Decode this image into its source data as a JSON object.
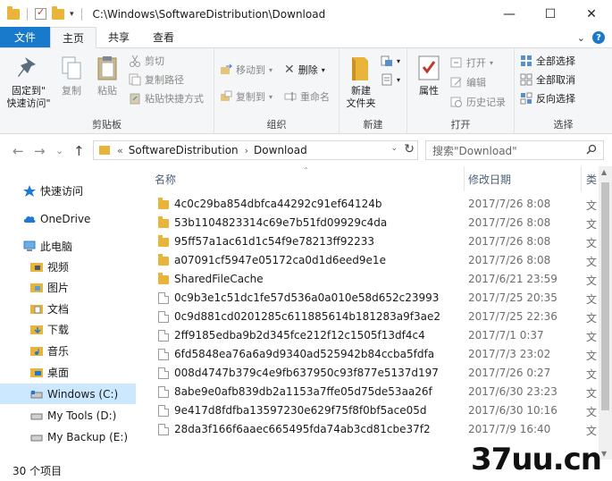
{
  "titlebar": {
    "title": "C:\\Windows\\SoftwareDistribution\\Download",
    "dropdown": "▾",
    "minimize": "—",
    "maximize": "☐",
    "close": "✕"
  },
  "tabs": {
    "file": "文件",
    "home": "主页",
    "share": "共享",
    "view": "查看",
    "collapse": "⌄",
    "help": "?"
  },
  "ribbon": {
    "clipboard": {
      "label": "剪贴板",
      "pin": "固定到\"\n快速访问\"",
      "pin_line1": "固定到\"",
      "pin_line2": "快速访问\"",
      "copy": "复制",
      "paste": "粘贴",
      "cut": "剪切",
      "copy_path": "复制路径",
      "paste_shortcut": "粘贴快捷方式"
    },
    "organize": {
      "label": "组织",
      "move_to": "移动到",
      "copy_to": "复制到",
      "delete": "删除",
      "rename": "重命名"
    },
    "new": {
      "label": "新建",
      "new_folder_line1": "新建",
      "new_folder_line2": "文件夹"
    },
    "open": {
      "label": "打开",
      "properties": "属性",
      "open": "打开",
      "edit": "编辑",
      "history": "历史记录"
    },
    "select": {
      "label": "选择",
      "select_all": "全部选择",
      "select_none": "全部取消",
      "invert": "反向选择"
    }
  },
  "nav": {
    "back": "←",
    "forward": "→",
    "recent": "⌄",
    "up": "↑",
    "address_prefix": "«",
    "address_segments": [
      "SoftwareDistribution",
      "Download"
    ],
    "address_arrow": "›",
    "address_drop": "⌄",
    "refresh": "↻",
    "search_placeholder": "搜索\"Download\"",
    "search_icon": "⌕"
  },
  "navpane": {
    "items": [
      {
        "label": "快速访问",
        "icon": "star-icon"
      },
      {
        "label": "OneDrive",
        "icon": "cloud-icon"
      },
      {
        "label": "此电脑",
        "icon": "computer-icon"
      },
      {
        "label": "视频",
        "icon": "video-folder-icon"
      },
      {
        "label": "图片",
        "icon": "pictures-folder-icon"
      },
      {
        "label": "文档",
        "icon": "documents-folder-icon"
      },
      {
        "label": "下载",
        "icon": "downloads-folder-icon"
      },
      {
        "label": "音乐",
        "icon": "music-folder-icon"
      },
      {
        "label": "桌面",
        "icon": "desktop-folder-icon"
      },
      {
        "label": "Windows (C:)",
        "icon": "drive-icon"
      },
      {
        "label": "My Tools (D:)",
        "icon": "drive-icon"
      },
      {
        "label": "My Backup (E:)",
        "icon": "drive-icon"
      }
    ]
  },
  "filelist": {
    "columns": {
      "name": "名称",
      "date": "修改日期",
      "type": "类"
    },
    "rows": [
      {
        "name": "4c0c29ba854dbfca44292c91ef64124b",
        "date": "2017/7/26 8:08",
        "type": "文",
        "kind": "folder"
      },
      {
        "name": "53b1104823314c69e7b51fd09929c4da",
        "date": "2017/7/26 8:08",
        "type": "文",
        "kind": "folder"
      },
      {
        "name": "95ff57a1ac61d1c54f9e78213ff92233",
        "date": "2017/7/26 8:08",
        "type": "文",
        "kind": "folder"
      },
      {
        "name": "a07091cf5947e05172ca0d1d6eed9e1e",
        "date": "2017/7/26 8:08",
        "type": "文",
        "kind": "folder"
      },
      {
        "name": "SharedFileCache",
        "date": "2017/6/21 23:59",
        "type": "文",
        "kind": "folder"
      },
      {
        "name": "0c9b3e1c51dc1fe57d536a0a010e58d652c23993",
        "date": "2017/7/25 20:35",
        "type": "文",
        "kind": "file"
      },
      {
        "name": "0c9d881cd0201285c611885614b181283a9f3ae2",
        "date": "2017/7/25 22:36",
        "type": "文",
        "kind": "file"
      },
      {
        "name": "2ff9185edba9b2d345fce212f12c1505f13df4c4",
        "date": "2017/7/1 0:37",
        "type": "文",
        "kind": "file"
      },
      {
        "name": "6fd5848ea76a6a9d9340ad525942b84ccba5fdfa",
        "date": "2017/7/3 23:02",
        "type": "文",
        "kind": "file"
      },
      {
        "name": "008d4747b379c4e9fb637950c93f877e5137d197",
        "date": "2017/7/26 0:27",
        "type": "文",
        "kind": "file"
      },
      {
        "name": "8abe9e0afb839db2a1153a7ffe05d75de53aa26f",
        "date": "2017/6/30 23:23",
        "type": "文",
        "kind": "file"
      },
      {
        "name": "9e417d8fdfba13597230e629f75f8f0bf5ace05d",
        "date": "2017/6/30 10:16",
        "type": "文",
        "kind": "file"
      },
      {
        "name": "28da3f166f6aaec665495fda74ab3cd81cbe37f2",
        "date": "2017/7/9 16:40",
        "type": "文",
        "kind": "file"
      }
    ]
  },
  "status": {
    "count": "30 个项目"
  },
  "watermark": "37uu.cn"
}
